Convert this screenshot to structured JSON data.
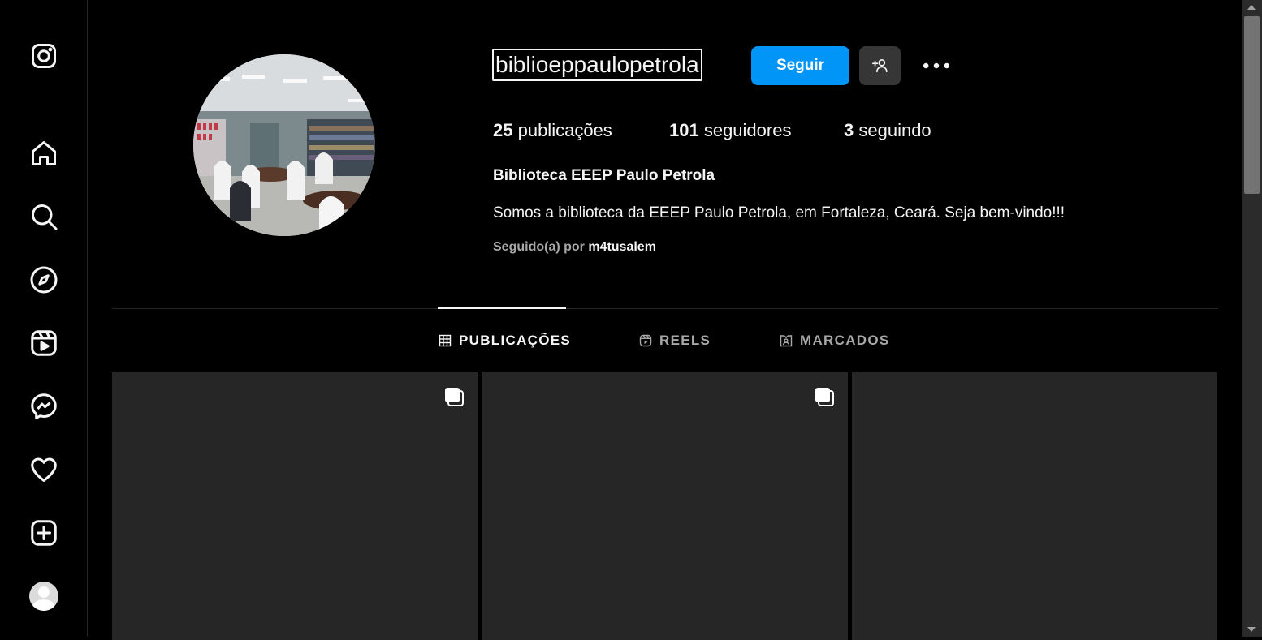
{
  "sidebar": {
    "items": [
      {
        "icon": "instagram-logo-icon"
      },
      {
        "icon": "home-icon"
      },
      {
        "icon": "search-icon"
      },
      {
        "icon": "explore-compass-icon"
      },
      {
        "icon": "reels-icon"
      },
      {
        "icon": "messenger-icon"
      },
      {
        "icon": "heart-icon"
      },
      {
        "icon": "create-plus-icon"
      },
      {
        "icon": "profile-avatar"
      }
    ]
  },
  "profile": {
    "username": "biblioeppaulopetrola",
    "follow_label": "Seguir",
    "stats": {
      "posts_count": "25",
      "posts_label": " publicações",
      "followers_count": "101",
      "followers_label": " seguidores",
      "following_count": "3",
      "following_label": " seguindo"
    },
    "full_name": "Biblioteca EEEP Paulo Petrola",
    "bio": "Somos a biblioteca da EEEP Paulo Petrola, em Fortaleza, Ceará. Seja bem-vindo!!!",
    "followed_by_prefix": "Seguido(a) por ",
    "followed_by_user": "m4tusalem"
  },
  "tabs": [
    {
      "label": "PUBLICAÇÕES",
      "icon": "grid-icon",
      "active": true
    },
    {
      "label": "REELS",
      "icon": "reels-icon",
      "active": false
    },
    {
      "label": "MARCADOS",
      "icon": "tagged-icon",
      "active": false
    }
  ],
  "posts": [
    {
      "type": "carousel"
    },
    {
      "type": "carousel"
    },
    {
      "type": "single"
    }
  ],
  "colors": {
    "background": "#000000",
    "accent": "#0095f6",
    "post_placeholder": "#262626"
  }
}
